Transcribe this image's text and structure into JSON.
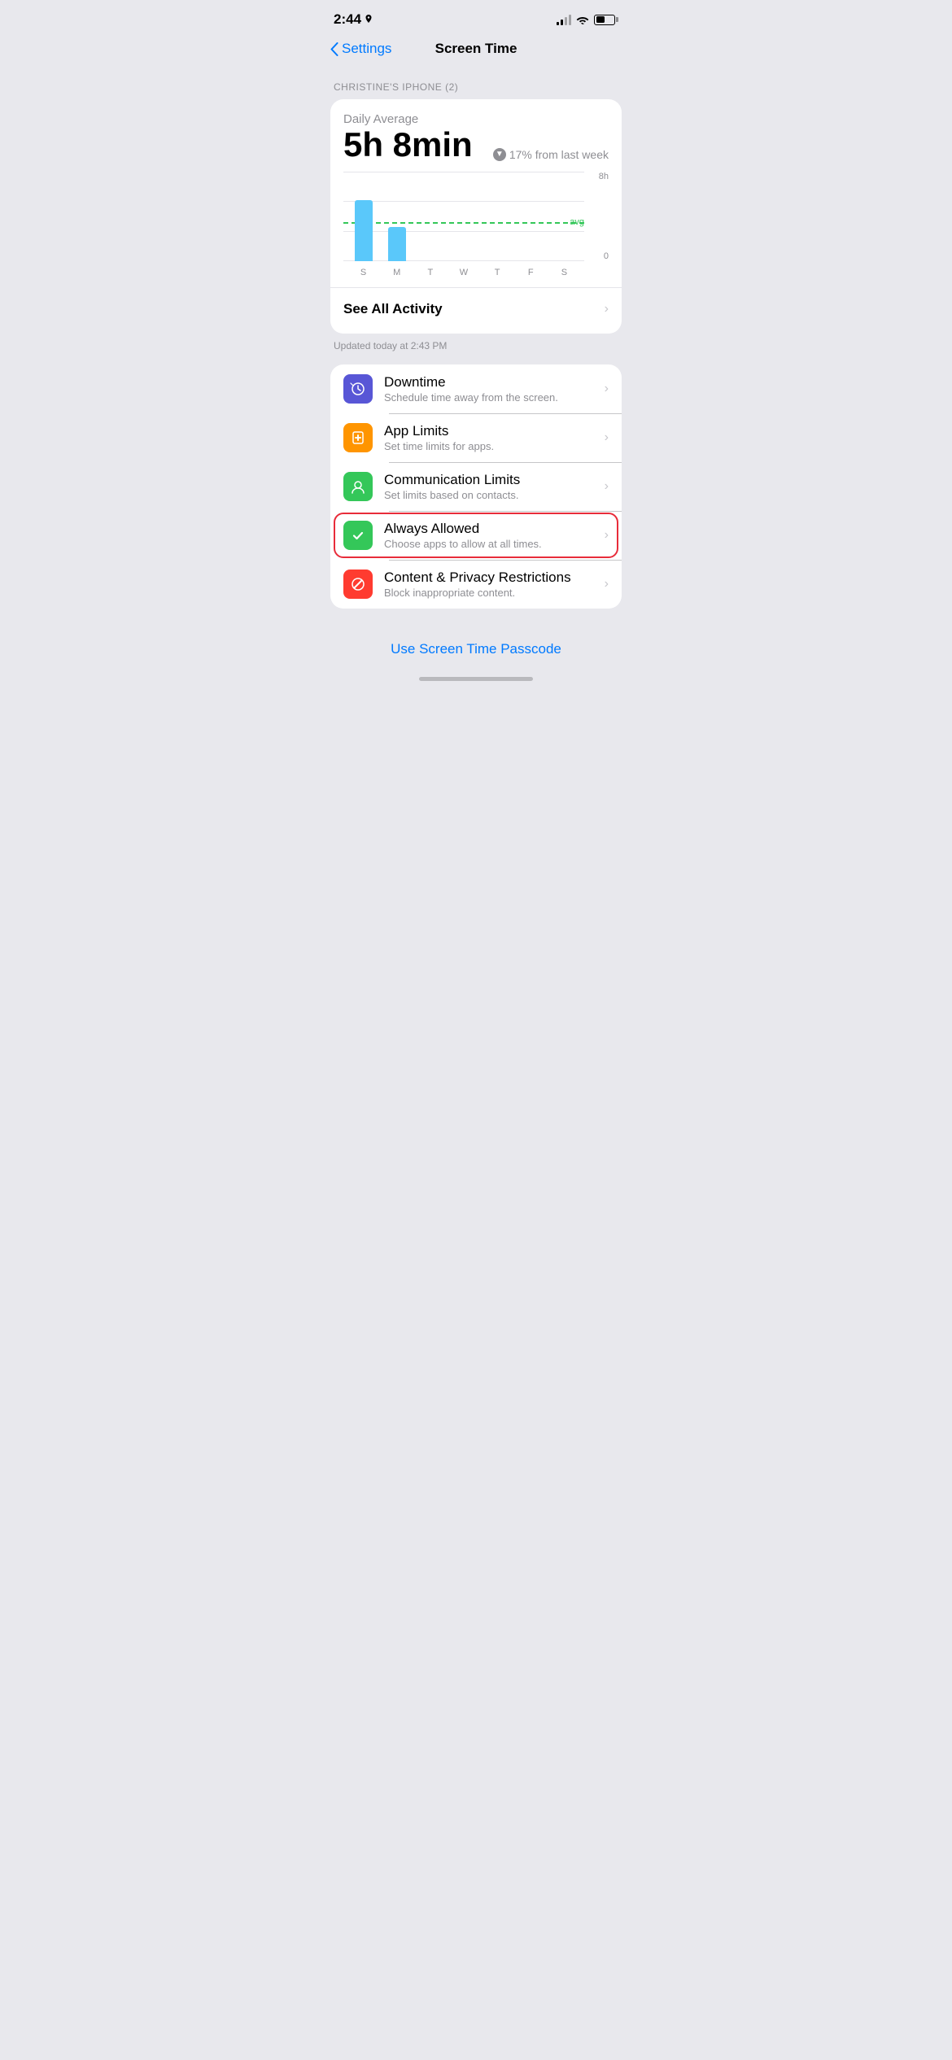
{
  "statusBar": {
    "time": "2:44",
    "signalBars": [
      1,
      2,
      3,
      4
    ],
    "signalActive": 2,
    "batteryLevel": 50
  },
  "nav": {
    "backLabel": "Settings",
    "title": "Screen Time"
  },
  "sectionLabel": "CHRISTINE'S IPHONE (2)",
  "activity": {
    "dailyAvgLabel": "Daily Average",
    "timeValue": "5h 8min",
    "changePercent": "17% from last week",
    "changeDirection": "down",
    "chart": {
      "yLabels": [
        "8h",
        "0"
      ],
      "avgLabel": "avg",
      "xLabels": [
        "S",
        "M",
        "T",
        "W",
        "T",
        "F",
        "S"
      ],
      "bars": [
        68,
        38,
        0,
        0,
        0,
        0,
        0
      ],
      "avgLinePercent": 52
    },
    "seeAllLabel": "See All Activity",
    "updateText": "Updated today at 2:43 PM"
  },
  "menuItems": [
    {
      "id": "downtime",
      "title": "Downtime",
      "subtitle": "Schedule time away from the screen.",
      "iconBg": "#5856d6",
      "iconColor": "#fff"
    },
    {
      "id": "app-limits",
      "title": "App Limits",
      "subtitle": "Set time limits for apps.",
      "iconBg": "#ff9500",
      "iconColor": "#fff"
    },
    {
      "id": "communication-limits",
      "title": "Communication Limits",
      "subtitle": "Set limits based on contacts.",
      "iconBg": "#34c759",
      "iconColor": "#fff"
    },
    {
      "id": "always-allowed",
      "title": "Always Allowed",
      "subtitle": "Choose apps to allow at all times.",
      "iconBg": "#34c759",
      "iconColor": "#fff",
      "highlighted": true
    },
    {
      "id": "content-privacy",
      "title": "Content & Privacy Restrictions",
      "subtitle": "Block inappropriate content.",
      "iconBg": "#ff3b30",
      "iconColor": "#fff"
    }
  ],
  "passcode": {
    "label": "Use Screen Time Passcode"
  }
}
